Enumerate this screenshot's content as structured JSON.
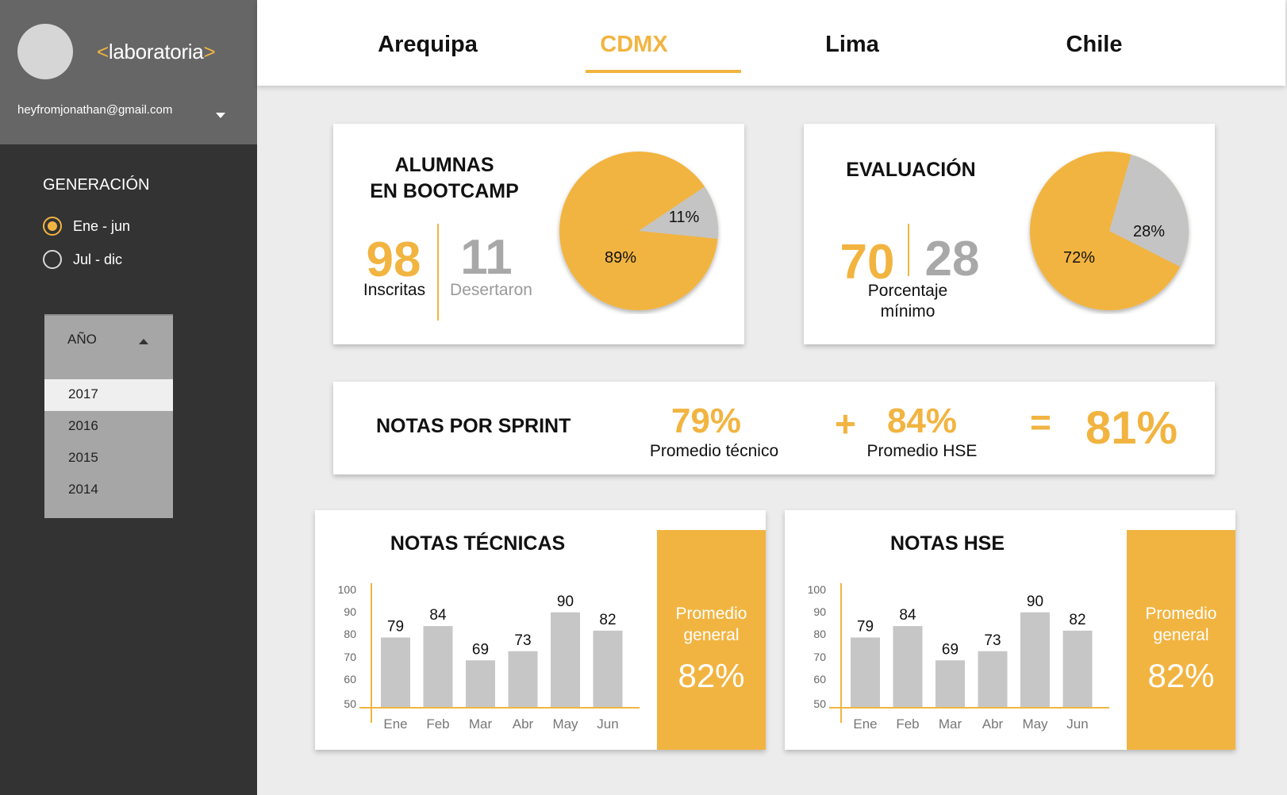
{
  "sidebar": {
    "logo_open": "<",
    "logo_text": "laboratoria",
    "logo_close": ">",
    "email": "heyfromjonathan@gmail.com",
    "generacion_title": "GENERACIÓN",
    "radio_options": [
      {
        "label": "Ene - jun",
        "checked": true
      },
      {
        "label": "Jul - dic",
        "checked": false
      }
    ],
    "year_dropdown": {
      "label": "AÑO",
      "options": [
        "2017",
        "2016",
        "2015",
        "2014"
      ],
      "selected": "2017"
    }
  },
  "tabs": [
    {
      "label": "Arequipa",
      "active": false
    },
    {
      "label": "CDMX",
      "active": true
    },
    {
      "label": "Lima",
      "active": false
    },
    {
      "label": "Chile",
      "active": false
    }
  ],
  "alumnas": {
    "title_line1": "ALUMNAS",
    "title_line2": "EN BOOTCAMP",
    "inscritas_value": "98",
    "inscritas_label": "Inscritas",
    "desertaron_value": "11",
    "desertaron_label": "Desertaron"
  },
  "evaluacion": {
    "title": "EVALUACIÓN",
    "value_main": "70",
    "value_secondary": "28",
    "label_line1": "Porcentaje",
    "label_line2": "mínimo"
  },
  "sprint": {
    "title": "NOTAS POR SPRINT",
    "tecnico_value": "79%",
    "tecnico_label": "Promedio técnico",
    "plus": "+",
    "hse_value": "84%",
    "hse_label": "Promedio HSE",
    "equals": "=",
    "total": "81%"
  },
  "notas_tecnicas": {
    "title": "NOTAS TÉCNICAS",
    "promedio_label_1": "Promedio",
    "promedio_label_2": "general",
    "promedio_value": "82%"
  },
  "notas_hse": {
    "title": "NOTAS HSE",
    "promedio_label_1": "Promedio",
    "promedio_label_2": "general",
    "promedio_value": "82%"
  },
  "colors": {
    "accent": "#f2b441",
    "pie_secondary": "#c4c4c4",
    "bar": "#c6c6c6",
    "sidebar_bg": "#333333",
    "profile_bg": "#666666"
  },
  "chart_data": [
    {
      "type": "pie",
      "title": "",
      "labels": [
        "89%",
        "11%"
      ],
      "values": [
        89,
        11
      ],
      "colors": [
        "#f2b441",
        "#c4c4c4"
      ]
    },
    {
      "type": "pie",
      "title": "",
      "labels": [
        "72%",
        "28%"
      ],
      "values": [
        72,
        28
      ],
      "colors": [
        "#f2b441",
        "#c4c4c4"
      ]
    },
    {
      "type": "bar",
      "title": "NOTAS TÉCNICAS",
      "categories": [
        "Ene",
        "Feb",
        "Mar",
        "Abr",
        "May",
        "Jun"
      ],
      "values": [
        79,
        84,
        69,
        73,
        90,
        82
      ],
      "yticks": [
        100,
        90,
        80,
        70,
        60,
        50
      ],
      "ylim": [
        45,
        100
      ],
      "xlabel": "",
      "ylabel": ""
    },
    {
      "type": "bar",
      "title": "NOTAS HSE",
      "categories": [
        "Ene",
        "Feb",
        "Mar",
        "Abr",
        "May",
        "Jun"
      ],
      "values": [
        79,
        84,
        69,
        73,
        90,
        82
      ],
      "yticks": [
        100,
        90,
        80,
        70,
        60,
        50
      ],
      "ylim": [
        45,
        100
      ],
      "xlabel": "",
      "ylabel": ""
    }
  ]
}
